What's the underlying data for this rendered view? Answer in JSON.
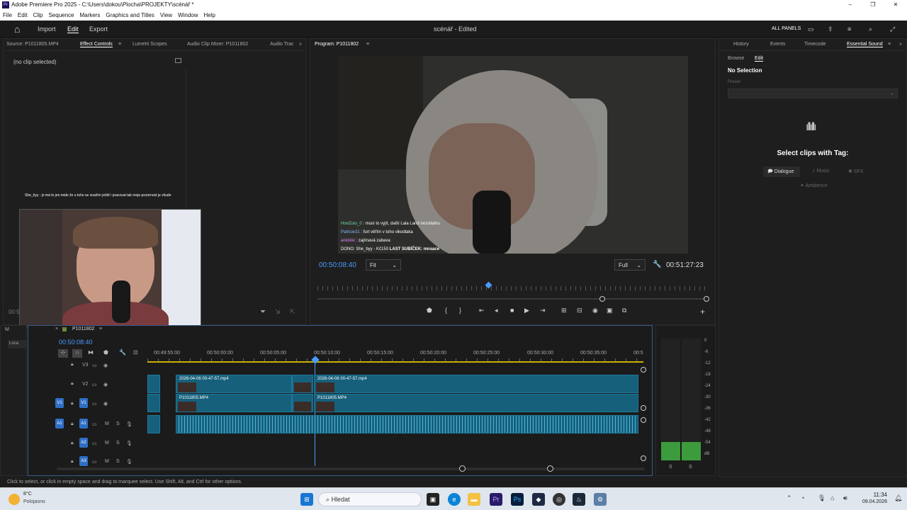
{
  "window": {
    "title": "Adobe Premiere Pro 2025 - C:\\Users\\dokou\\Plocha\\PROJEKTY\\scénář *",
    "min": "–",
    "max": "❐",
    "close": "✕"
  },
  "menu": [
    "File",
    "Edit",
    "Clip",
    "Sequence",
    "Markers",
    "Graphics and Titles",
    "View",
    "Window",
    "Help"
  ],
  "appbar": {
    "home": "⌂",
    "import": "Import",
    "edit": "Edit",
    "export": "Export",
    "project_status": "scénář - Edited",
    "all_panels": "ALL PANELS"
  },
  "source_panel": {
    "tabs": [
      "Source: P1011805.MP4",
      "Effect Controls",
      "Lumetri Scopes",
      "Audio Clip Mixer: P1011802",
      "Audio Trac"
    ],
    "no_clip": "(no clip selected)",
    "chat_line": "She_byy : jo má to jen málo že u toho se snažím ještě i pracovat tak moje pozornost je všude",
    "time_left": "00:5"
  },
  "program": {
    "tab": "Program: P1011802",
    "timecode": "00:50:08:40",
    "fit": "Fit",
    "resolution": "Full",
    "duration": "00:51:27:23",
    "chat": [
      {
        "user": "HonZuto_0",
        "msg": ": musí to vyjít, další Lala Land nezvládnu"
      },
      {
        "user": "Patricie31",
        "msg": ": furt věřím v toho vikodlaka"
      },
      {
        "user": "anickiki",
        "msg": ": zajímavá zabava"
      }
    ],
    "donation": "DONO: She_byy - Kč150",
    "last_sub": "LAST SUBÍČEK: mnsace"
  },
  "right_panel": {
    "tabs": [
      "History",
      "Events",
      "Timecode",
      "Essential Sound"
    ],
    "subtabs": [
      "Browse",
      "Edit"
    ],
    "selection": "No Selection",
    "preset_label": "Preset:",
    "select_msg": "Select clips with Tag:",
    "tags": [
      "Dialogue",
      "Music",
      "SFX",
      "Ambience"
    ]
  },
  "timeline": {
    "sequence_name": "P1011802",
    "timecode": "00:50:08:40",
    "ruler": [
      "00:49:55:00",
      "00:50:00:00",
      "00:50:05:00",
      "00:50:10:00",
      "00:50:15:00",
      "00:50:20:00",
      "00:50:25:00",
      "00:50:30:00",
      "00:50:35:00",
      "00:5"
    ],
    "tracks": [
      {
        "name": "V3"
      },
      {
        "name": "V2"
      },
      {
        "name": "V1"
      },
      {
        "name": "A1"
      },
      {
        "name": "A2"
      },
      {
        "name": "A3"
      }
    ],
    "clips": {
      "v2a": "2026-04-06 00-47-57.mp4",
      "v2b": "2026-04-06 00-47-57.mp4",
      "v1a": "P1011805.MP4",
      "v1b": "P1011805.MP4"
    },
    "left_labels": [
      "M",
      "Loca"
    ]
  },
  "meter": {
    "scale": [
      "0",
      "-6",
      "-12",
      "-18",
      "-24",
      "-30",
      "-36",
      "-42",
      "-48",
      "-54",
      "dB"
    ],
    "left": "S",
    "right": "S",
    "left_level": 0.15,
    "right_level": 0.15
  },
  "status": "Click to select, or click in empty space and drag to marquee select. Use Shift, Alt, and Ctrl for other options.",
  "taskbar": {
    "weather_temp": "8°C",
    "weather_desc": "Polojasno",
    "search_placeholder": "Hledat",
    "time": "11:34",
    "date": "09.04.2026"
  }
}
